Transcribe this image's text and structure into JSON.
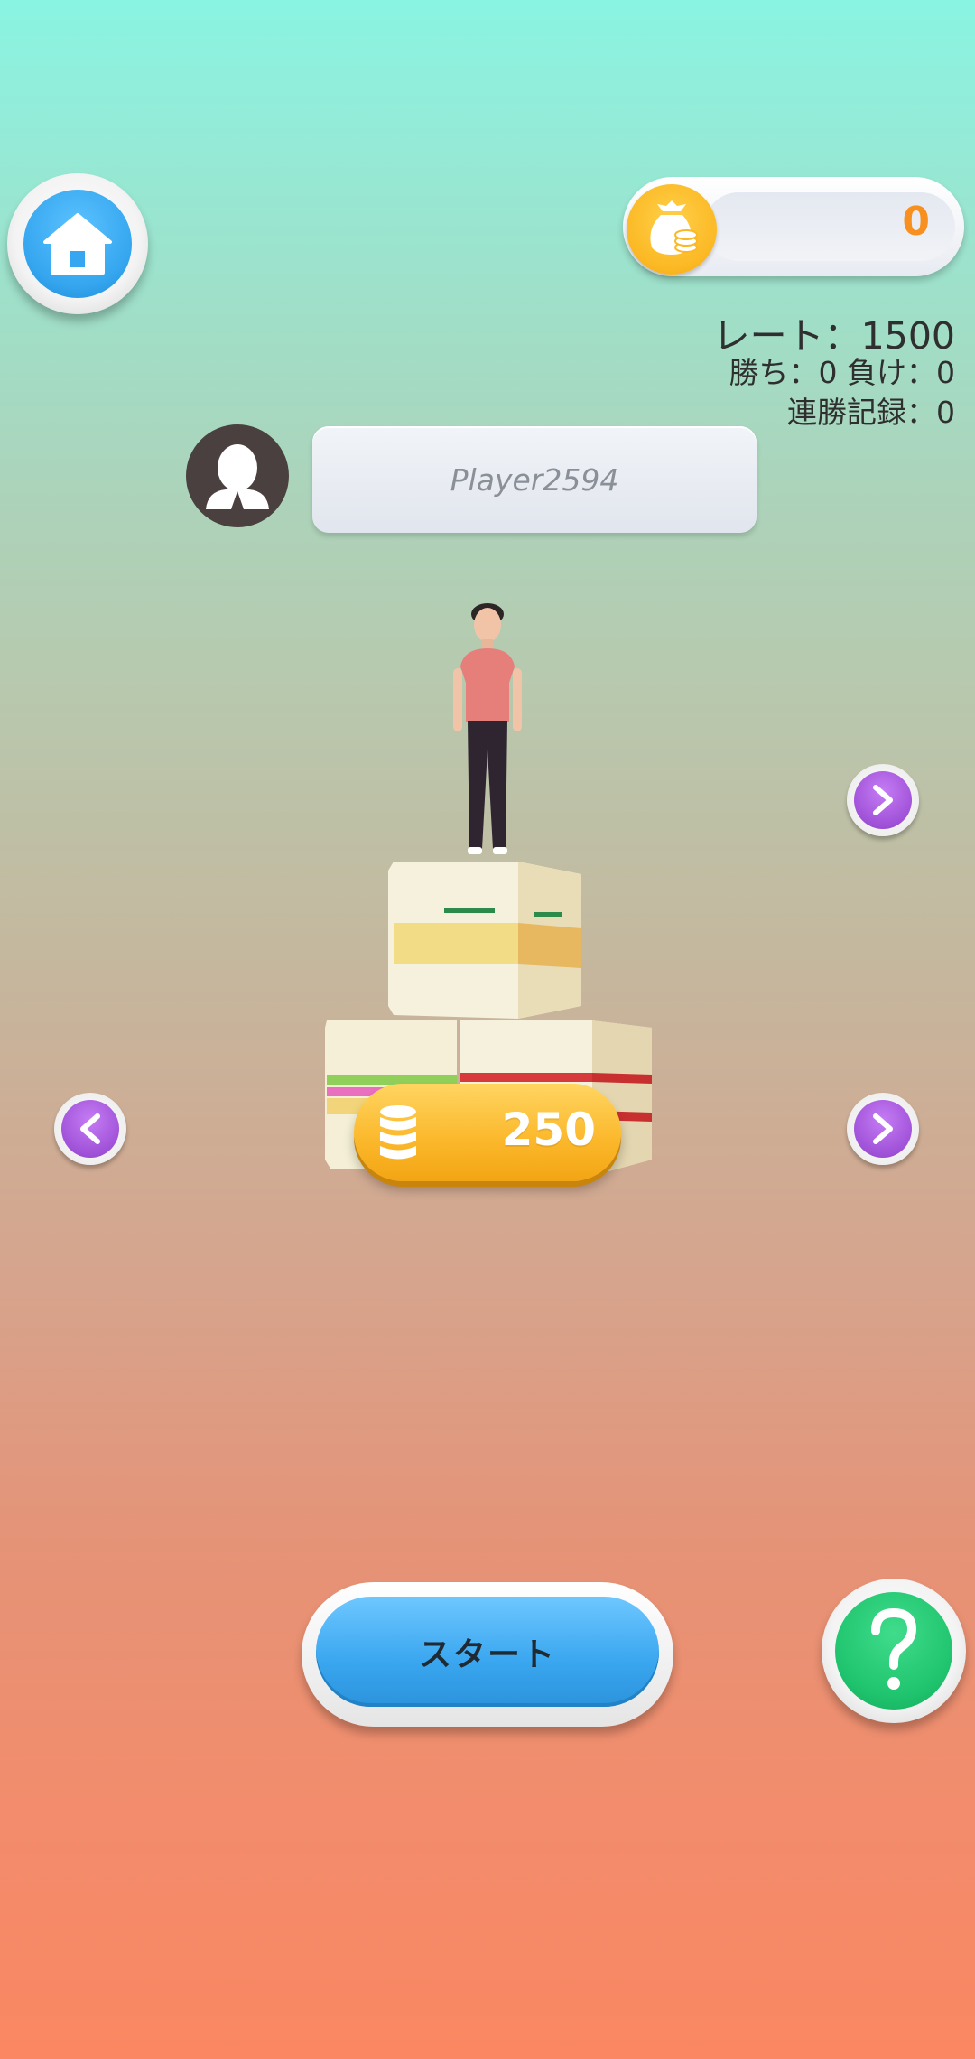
{
  "header": {
    "home_icon": "home-icon",
    "coin_icon": "money-bag-icon",
    "coin_count": "0"
  },
  "stats": {
    "rate": "レート：1500",
    "win_loss": "勝ち：0 負け：0",
    "streak": "連勝記録：0"
  },
  "player": {
    "avatar_icon": "user-avatar-icon",
    "name": "Player2594"
  },
  "character_select": {
    "price": "250",
    "price_icon": "coin-stack-icon",
    "prev_icon": "chevron-left-icon",
    "next_icon": "chevron-right-icon"
  },
  "actions": {
    "start_label": "スタート",
    "help_icon": "question-mark-icon"
  },
  "colors": {
    "home_blue": "#35a6ef",
    "coin_orange": "#f7901e",
    "arrow_purple": "#a052d8",
    "price_yellow": "#fbb72a",
    "start_blue": "#39a6ef",
    "help_green": "#20c46e"
  }
}
